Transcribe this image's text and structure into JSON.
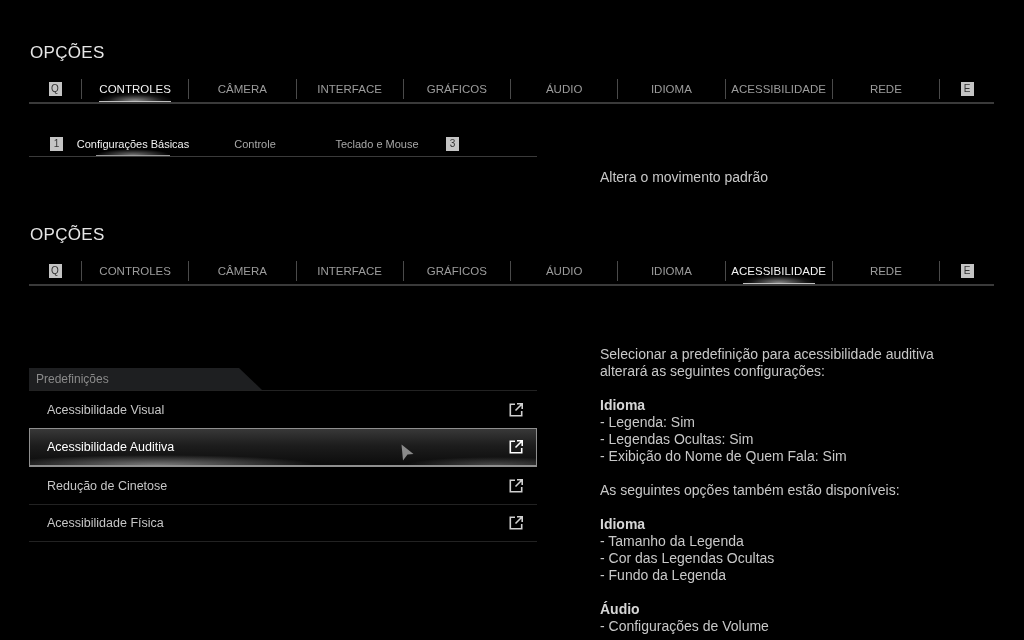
{
  "panels": [
    {
      "title": "OPÇÕES",
      "prev_key": "Q",
      "next_key": "E",
      "tabs": [
        {
          "label": "CONTROLES",
          "selected": true
        },
        {
          "label": "CÂMERA",
          "selected": false
        },
        {
          "label": "INTERFACE",
          "selected": false
        },
        {
          "label": "GRÁFICOS",
          "selected": false
        },
        {
          "label": "ÁUDIO",
          "selected": false
        },
        {
          "label": "IDIOMA",
          "selected": false
        },
        {
          "label": "ACESSIBILIDADE",
          "selected": false
        },
        {
          "label": "REDE",
          "selected": false
        }
      ],
      "subtabs": {
        "prev_key": "1",
        "next_key": "3",
        "items": [
          {
            "label": "Configurações Básicas",
            "selected": true
          },
          {
            "label": "Controle",
            "selected": false
          },
          {
            "label": "Teclado e Mouse",
            "selected": false
          }
        ]
      },
      "details": [
        {
          "kind": "paragraph",
          "text": "Altera o movimento padrão"
        }
      ]
    },
    {
      "title": "OPÇÕES",
      "prev_key": "Q",
      "next_key": "E",
      "tabs": [
        {
          "label": "CONTROLES",
          "selected": false
        },
        {
          "label": "CÂMERA",
          "selected": false
        },
        {
          "label": "INTERFACE",
          "selected": false
        },
        {
          "label": "GRÁFICOS",
          "selected": false
        },
        {
          "label": "ÁUDIO",
          "selected": false
        },
        {
          "label": "IDIOMA",
          "selected": false
        },
        {
          "label": "ACESSIBILIDADE",
          "selected": true
        },
        {
          "label": "REDE",
          "selected": false
        }
      ],
      "presets": {
        "header": "Predefinições",
        "items": [
          {
            "label": "Acessibilidade Visual",
            "selected": false
          },
          {
            "label": "Acessibilidade Auditiva",
            "selected": true
          },
          {
            "label": "Redução de Cinetose",
            "selected": false
          },
          {
            "label": "Acessibilidade Física",
            "selected": false
          }
        ]
      },
      "details": [
        {
          "kind": "paragraph",
          "text": "Selecionar a predefinição para acessibilidade auditiva alterará as seguintes configurações:"
        },
        {
          "kind": "section",
          "heading": "Idioma",
          "items": [
            "- Legenda: Sim",
            "- Legendas Ocultas: Sim",
            "- Exibição do Nome de Quem Fala: Sim"
          ]
        },
        {
          "kind": "paragraph",
          "text": "As seguintes opções também estão disponíveis:"
        },
        {
          "kind": "section",
          "heading": "Idioma",
          "items": [
            "- Tamanho da Legenda",
            "- Cor das Legendas Ocultas",
            "- Fundo da Legenda"
          ]
        },
        {
          "kind": "section",
          "heading": "Áudio",
          "items": [
            "- Configurações de Volume"
          ]
        }
      ]
    }
  ]
}
